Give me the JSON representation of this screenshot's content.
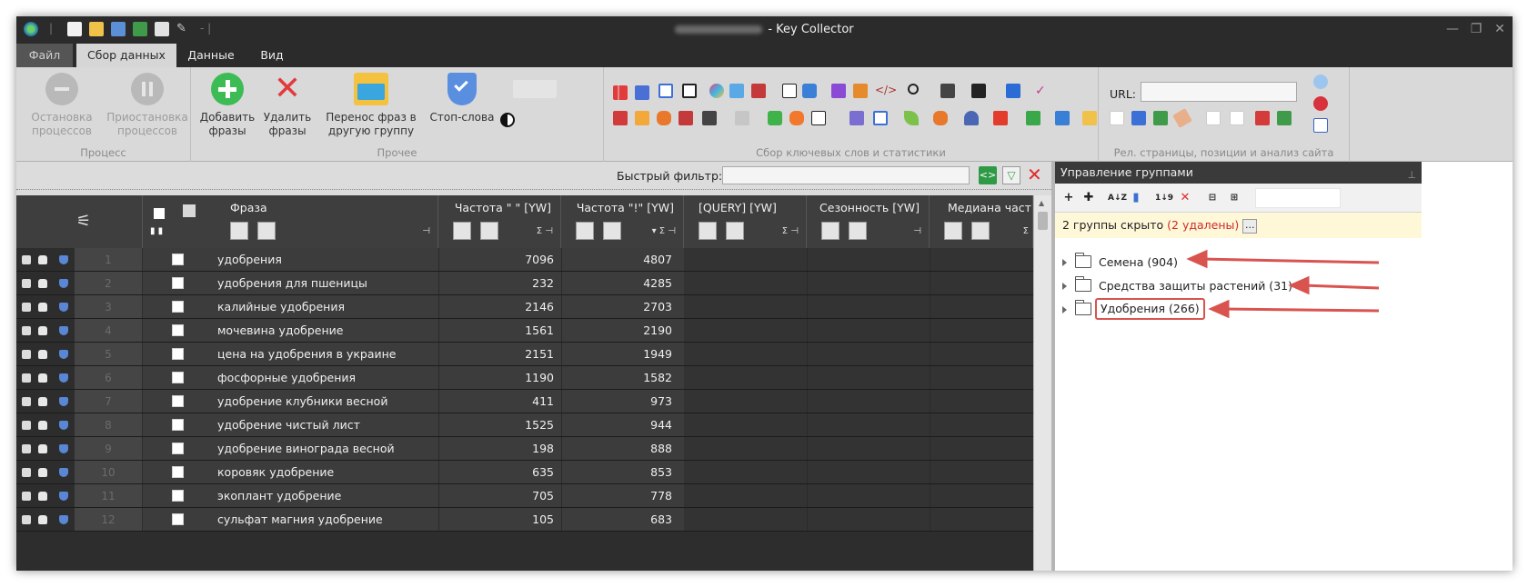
{
  "app": {
    "title": "- Key Collector"
  },
  "tabs": [
    "Файл",
    "Сбор данных",
    "Данные",
    "Вид"
  ],
  "ribbon": {
    "process": {
      "label": "Процесс",
      "stop": "Остановка процессов",
      "pause": "Приостановка процессов"
    },
    "other": {
      "label": "Прочее",
      "add": "Добавить фразы",
      "delete": "Удалить фразы",
      "move": "Перенос фраз в другую группу",
      "stop_words": "Стоп-слова"
    },
    "collect": {
      "label": "Сбор ключевых слов и статистики"
    },
    "rel": {
      "label": "Рел. страницы, позиции и анализ сайта",
      "url_label": "URL:"
    }
  },
  "filter": {
    "label": "Быстрый фильтр:",
    "value": ""
  },
  "grid": {
    "headers": {
      "phrase": "Фраза",
      "freq_quoted": "Частота \" \" [YW]",
      "freq_excl": "Частота \"!\" [YW]",
      "query": "[QUERY] [YW]",
      "season": "Сезонность [YW]",
      "median": "Медиана част"
    },
    "rows": [
      {
        "n": "1",
        "phrase": "удобрения",
        "f1": "7096",
        "f2": "4807"
      },
      {
        "n": "2",
        "phrase": "удобрения для пшеницы",
        "f1": "232",
        "f2": "4285"
      },
      {
        "n": "3",
        "phrase": "калийные удобрения",
        "f1": "2146",
        "f2": "2703"
      },
      {
        "n": "4",
        "phrase": "мочевина удобрение",
        "f1": "1561",
        "f2": "2190"
      },
      {
        "n": "5",
        "phrase": "цена на удобрения в украине",
        "f1": "2151",
        "f2": "1949"
      },
      {
        "n": "6",
        "phrase": "фосфорные удобрения",
        "f1": "1190",
        "f2": "1582"
      },
      {
        "n": "7",
        "phrase": "удобрение клубники весной",
        "f1": "411",
        "f2": "973"
      },
      {
        "n": "8",
        "phrase": "удобрение чистый лист",
        "f1": "1525",
        "f2": "944"
      },
      {
        "n": "9",
        "phrase": "удобрение винограда весной",
        "f1": "198",
        "f2": "888"
      },
      {
        "n": "10",
        "phrase": "коровяк удобрение",
        "f1": "635",
        "f2": "853"
      },
      {
        "n": "11",
        "phrase": "экоплант удобрение",
        "f1": "705",
        "f2": "778"
      },
      {
        "n": "12",
        "phrase": "сульфат магния удобрение",
        "f1": "105",
        "f2": "683"
      }
    ]
  },
  "panel": {
    "title": "Управление группами",
    "hidden_prefix": "2 группы скрыто ",
    "hidden_deleted": "(2 удалены)",
    "groups": [
      "Семена (904)",
      "Средства защиты растений (31)",
      "Удобрения (266)"
    ]
  },
  "colors": {
    "accent_red": "#d9534f",
    "bg_dark": "#2d2d2d",
    "ribbon": "#d9d9d9"
  }
}
